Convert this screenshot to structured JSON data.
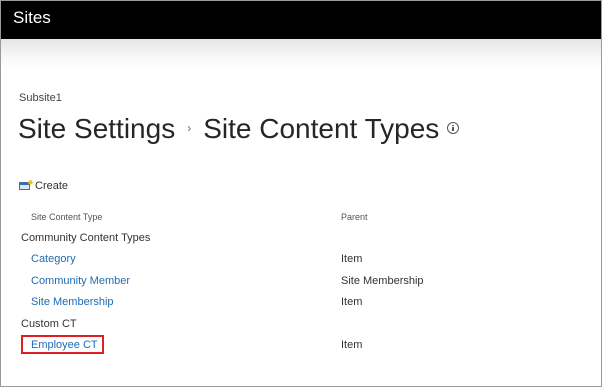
{
  "suite_bar": {
    "brand": "Sites"
  },
  "breadcrumb": "Subsite1",
  "title": {
    "part1": "Site Settings",
    "separator": "›",
    "part2": "Site Content Types"
  },
  "toolbar": {
    "create_label": "Create"
  },
  "table": {
    "columns": [
      "Site Content Type",
      "Parent"
    ],
    "groups": [
      {
        "name": "Community Content Types",
        "rows": [
          {
            "name": "Category",
            "parent": "Item"
          },
          {
            "name": "Community Member",
            "parent": "Site Membership"
          },
          {
            "name": "Site Membership",
            "parent": "Item"
          }
        ]
      },
      {
        "name": "Custom CT",
        "rows": [
          {
            "name": "Employee CT",
            "parent": "Item",
            "highlighted": true
          }
        ]
      }
    ]
  },
  "colors": {
    "link": "#1f6bb5",
    "highlight": "#e02020",
    "suite_bar": "#000000"
  }
}
